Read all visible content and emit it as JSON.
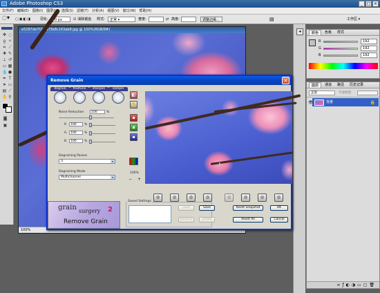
{
  "app": {
    "title": "Adobe Photoshop CS3",
    "window_buttons": [
      "_",
      "□",
      "×"
    ]
  },
  "menu": [
    "文件(F)",
    "编辑(E)",
    "图像(I)",
    "图层(L)",
    "选择(S)",
    "滤镜(T)",
    "分析(A)",
    "视图(V)",
    "窗口(W)",
    "帮助(H)"
  ],
  "options": {
    "feather_label": "羽化:",
    "feather_value": "0 px",
    "antialias_label": "消除锯齿",
    "style_label": "样式:",
    "style_value": "正常",
    "width_label": "宽度:",
    "height_label": "高度:",
    "refine_label": "调整边缘...",
    "workspace": "工作区 ▾"
  },
  "document": {
    "title": "e5287de7f27e2f3b8c163ab8.jpg @ 100%(RGB/8#)",
    "zoom": "100%"
  },
  "color_panel": {
    "tabs": [
      "颜色",
      "色板",
      "样式"
    ],
    "channels": [
      {
        "label": "R",
        "value": "192"
      },
      {
        "label": "G",
        "value": "192"
      },
      {
        "label": "B",
        "value": "192"
      }
    ]
  },
  "layers_panel": {
    "tabs": [
      "图层",
      "通道",
      "路径"
    ],
    "opacity_label": "不透明度:",
    "fill_label": "填充:",
    "mode": "正常",
    "history_tabs": [
      "历史记录"
    ],
    "layer_name": "背景"
  },
  "dialog": {
    "title": "Remove Grain",
    "tabs": [
      "degrain",
      "finetune",
      "sharpen",
      "sample"
    ],
    "noise_reduction_label": "Noise Reduction",
    "noise_reduction_value": "100",
    "percent": "%",
    "channels": [
      {
        "label": "R",
        "value": "100"
      },
      {
        "label": "G",
        "value": "100"
      },
      {
        "label": "B",
        "value": "100"
      }
    ],
    "degraining_passes_label": "Degraining Passes",
    "degraining_passes_value": "3",
    "degraining_mode_label": "Degraining Mode",
    "degraining_mode_value": "Multichannel",
    "zoom": "100%",
    "zoom_minus": "−",
    "zoom_plus": "+",
    "saved_settings_label": "Saved Settings",
    "buttons": {
      "load": "Load",
      "save": "Save",
      "rename": "Rename",
      "delete": "Delete",
      "reset_snapshot": "Reset Snapshot",
      "reset_all": "Reset All",
      "ok": "OK",
      "cancel": "Cancel"
    },
    "logo": {
      "line1": "grain",
      "line2": "surgery",
      "version": "2",
      "line3": "Remove Grain"
    }
  }
}
